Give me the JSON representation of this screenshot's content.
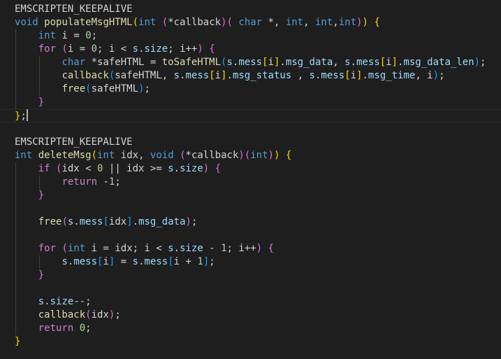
{
  "editor": {
    "colors": {
      "background": "#1e1e1e",
      "text": "#d4d4d4",
      "keyword": "#569cd6",
      "control": "#c586c0",
      "function": "#dcdcaa",
      "variable": "#9cdcfe",
      "number": "#b5cea8",
      "bracket_1": "#ffd700",
      "bracket_2": "#da70d6",
      "bracket_3": "#179fff"
    },
    "lines": [
      [
        {
          "t": "EMSCRIPTEN_KEEPALIVE"
        }
      ],
      [
        {
          "t": "void",
          "c": "kw"
        },
        {
          "t": " "
        },
        {
          "t": "populateMsgHTML",
          "c": "fn"
        },
        {
          "t": "(",
          "c": "b1"
        },
        {
          "t": "int",
          "c": "kw"
        },
        {
          "t": " "
        },
        {
          "t": "(",
          "c": "b2"
        },
        {
          "t": "*"
        },
        {
          "t": "callback"
        },
        {
          "t": ")",
          "c": "b2"
        },
        {
          "t": "(",
          "c": "b2"
        },
        {
          "t": " "
        },
        {
          "t": "char",
          "c": "kw"
        },
        {
          "t": " *, "
        },
        {
          "t": "int",
          "c": "kw"
        },
        {
          "t": ", "
        },
        {
          "t": "int",
          "c": "kw"
        },
        {
          "t": ","
        },
        {
          "t": "int",
          "c": "kw"
        },
        {
          "t": ")",
          "c": "b2"
        },
        {
          "t": ")",
          "c": "b1"
        },
        {
          "t": " "
        },
        {
          "t": "{",
          "c": "b1"
        }
      ],
      [
        {
          "t": "    "
        },
        {
          "t": "int",
          "c": "kw"
        },
        {
          "t": " "
        },
        {
          "t": "i"
        },
        {
          "t": " = "
        },
        {
          "t": "0",
          "c": "num"
        },
        {
          "t": ";"
        }
      ],
      [
        {
          "t": "    "
        },
        {
          "t": "for",
          "c": "ctl"
        },
        {
          "t": " "
        },
        {
          "t": "(",
          "c": "b2"
        },
        {
          "t": "i = "
        },
        {
          "t": "0",
          "c": "num"
        },
        {
          "t": "; i < "
        },
        {
          "t": "s",
          "c": "var"
        },
        {
          "t": "."
        },
        {
          "t": "size",
          "c": "var"
        },
        {
          "t": "; i++"
        },
        {
          "t": ")",
          "c": "b2"
        },
        {
          "t": " "
        },
        {
          "t": "{",
          "c": "b2"
        }
      ],
      [
        {
          "t": "        "
        },
        {
          "t": "char",
          "c": "kw"
        },
        {
          "t": " *safeHTML = "
        },
        {
          "t": "toSafeHTML",
          "c": "fn"
        },
        {
          "t": "(",
          "c": "b3"
        },
        {
          "t": "s",
          "c": "var"
        },
        {
          "t": "."
        },
        {
          "t": "mess",
          "c": "var"
        },
        {
          "t": "[",
          "c": "b1"
        },
        {
          "t": "i"
        },
        {
          "t": "]",
          "c": "b1"
        },
        {
          "t": "."
        },
        {
          "t": "msg_data",
          "c": "var"
        },
        {
          "t": ", "
        },
        {
          "t": "s",
          "c": "var"
        },
        {
          "t": "."
        },
        {
          "t": "mess",
          "c": "var"
        },
        {
          "t": "[",
          "c": "b1"
        },
        {
          "t": "i"
        },
        {
          "t": "]",
          "c": "b1"
        },
        {
          "t": "."
        },
        {
          "t": "msg_data_len",
          "c": "var"
        },
        {
          "t": ")",
          "c": "b3"
        },
        {
          "t": ";"
        }
      ],
      [
        {
          "t": "        "
        },
        {
          "t": "callback",
          "c": "fn"
        },
        {
          "t": "(",
          "c": "b3"
        },
        {
          "t": "safeHTML, "
        },
        {
          "t": "s",
          "c": "var"
        },
        {
          "t": "."
        },
        {
          "t": "mess",
          "c": "var"
        },
        {
          "t": "[",
          "c": "b1"
        },
        {
          "t": "i"
        },
        {
          "t": "]",
          "c": "b1"
        },
        {
          "t": "."
        },
        {
          "t": "msg_status",
          "c": "var"
        },
        {
          "t": " , "
        },
        {
          "t": "s",
          "c": "var"
        },
        {
          "t": "."
        },
        {
          "t": "mess",
          "c": "var"
        },
        {
          "t": "[",
          "c": "b1"
        },
        {
          "t": "i"
        },
        {
          "t": "]",
          "c": "b1"
        },
        {
          "t": "."
        },
        {
          "t": "msg_time",
          "c": "var"
        },
        {
          "t": ", i"
        },
        {
          "t": ")",
          "c": "b3"
        },
        {
          "t": ";"
        }
      ],
      [
        {
          "t": "        "
        },
        {
          "t": "free",
          "c": "fn"
        },
        {
          "t": "(",
          "c": "b3"
        },
        {
          "t": "safeHTML"
        },
        {
          "t": ")",
          "c": "b3"
        },
        {
          "t": ";"
        }
      ],
      [
        {
          "t": "    "
        },
        {
          "t": "}",
          "c": "b2"
        }
      ],
      [
        {
          "t": "}",
          "c": "b1"
        },
        {
          "t": ";"
        }
      ],
      [],
      [
        {
          "t": "EMSCRIPTEN_KEEPALIVE"
        }
      ],
      [
        {
          "t": "int",
          "c": "kw"
        },
        {
          "t": " "
        },
        {
          "t": "deleteMsg",
          "c": "fn"
        },
        {
          "t": "(",
          "c": "b1"
        },
        {
          "t": "int",
          "c": "kw"
        },
        {
          "t": " "
        },
        {
          "t": "idx"
        },
        {
          "t": ", "
        },
        {
          "t": "void",
          "c": "kw"
        },
        {
          "t": " "
        },
        {
          "t": "(",
          "c": "b2"
        },
        {
          "t": "*callback"
        },
        {
          "t": ")",
          "c": "b2"
        },
        {
          "t": "(",
          "c": "b2"
        },
        {
          "t": "int",
          "c": "kw"
        },
        {
          "t": ")",
          "c": "b2"
        },
        {
          "t": ")",
          "c": "b1"
        },
        {
          "t": " "
        },
        {
          "t": "{",
          "c": "b1"
        }
      ],
      [
        {
          "t": "    "
        },
        {
          "t": "if",
          "c": "ctl"
        },
        {
          "t": " "
        },
        {
          "t": "(",
          "c": "b2"
        },
        {
          "t": "idx < "
        },
        {
          "t": "0",
          "c": "num"
        },
        {
          "t": " || idx >= "
        },
        {
          "t": "s",
          "c": "var"
        },
        {
          "t": "."
        },
        {
          "t": "size",
          "c": "var"
        },
        {
          "t": ")",
          "c": "b2"
        },
        {
          "t": " "
        },
        {
          "t": "{",
          "c": "b2"
        }
      ],
      [
        {
          "t": "        "
        },
        {
          "t": "return",
          "c": "ctl"
        },
        {
          "t": " -"
        },
        {
          "t": "1",
          "c": "num"
        },
        {
          "t": ";"
        }
      ],
      [
        {
          "t": "    "
        },
        {
          "t": "}",
          "c": "b2"
        }
      ],
      [],
      [
        {
          "t": "    "
        },
        {
          "t": "free",
          "c": "fn"
        },
        {
          "t": "(",
          "c": "b2"
        },
        {
          "t": "s",
          "c": "var"
        },
        {
          "t": "."
        },
        {
          "t": "mess",
          "c": "var"
        },
        {
          "t": "[",
          "c": "b3"
        },
        {
          "t": "idx"
        },
        {
          "t": "]",
          "c": "b3"
        },
        {
          "t": "."
        },
        {
          "t": "msg_data",
          "c": "var"
        },
        {
          "t": ")",
          "c": "b2"
        },
        {
          "t": ";"
        }
      ],
      [],
      [
        {
          "t": "    "
        },
        {
          "t": "for",
          "c": "ctl"
        },
        {
          "t": " "
        },
        {
          "t": "(",
          "c": "b2"
        },
        {
          "t": "int",
          "c": "kw"
        },
        {
          "t": " i = idx; i < "
        },
        {
          "t": "s",
          "c": "var"
        },
        {
          "t": "."
        },
        {
          "t": "size",
          "c": "var"
        },
        {
          "t": " - "
        },
        {
          "t": "1",
          "c": "num"
        },
        {
          "t": "; i++"
        },
        {
          "t": ")",
          "c": "b2"
        },
        {
          "t": " "
        },
        {
          "t": "{",
          "c": "b2"
        }
      ],
      [
        {
          "t": "        "
        },
        {
          "t": "s",
          "c": "var"
        },
        {
          "t": "."
        },
        {
          "t": "mess",
          "c": "var"
        },
        {
          "t": "[",
          "c": "b3"
        },
        {
          "t": "i"
        },
        {
          "t": "]",
          "c": "b3"
        },
        {
          "t": " = "
        },
        {
          "t": "s",
          "c": "var"
        },
        {
          "t": "."
        },
        {
          "t": "mess",
          "c": "var"
        },
        {
          "t": "[",
          "c": "b3"
        },
        {
          "t": "i + "
        },
        {
          "t": "1",
          "c": "num"
        },
        {
          "t": "]",
          "c": "b3"
        },
        {
          "t": ";"
        }
      ],
      [
        {
          "t": "    "
        },
        {
          "t": "}",
          "c": "b2"
        }
      ],
      [],
      [
        {
          "t": "    "
        },
        {
          "t": "s",
          "c": "var"
        },
        {
          "t": "."
        },
        {
          "t": "size",
          "c": "var"
        },
        {
          "t": "--;"
        }
      ],
      [
        {
          "t": "    "
        },
        {
          "t": "callback",
          "c": "fn"
        },
        {
          "t": "(",
          "c": "b2"
        },
        {
          "t": "idx"
        },
        {
          "t": ")",
          "c": "b2"
        },
        {
          "t": ";"
        }
      ],
      [
        {
          "t": "    "
        },
        {
          "t": "return",
          "c": "ctl"
        },
        {
          "t": " "
        },
        {
          "t": "0",
          "c": "num"
        },
        {
          "t": ";"
        }
      ],
      [
        {
          "t": "}",
          "c": "b1"
        }
      ]
    ]
  }
}
